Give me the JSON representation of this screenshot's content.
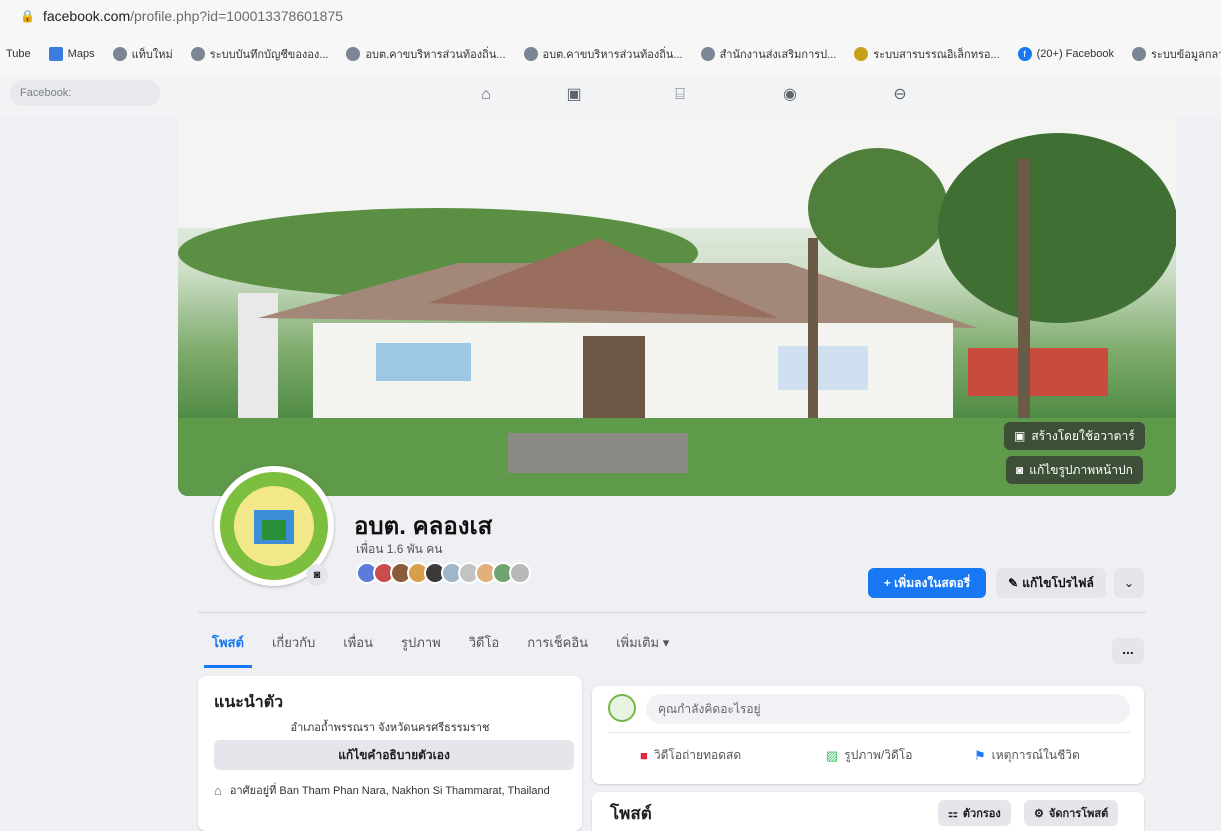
{
  "browser": {
    "url_host": "facebook.com",
    "url_path": "/profile.php?id=100013378601875",
    "bookmarks": [
      {
        "icon": "youtube-icon",
        "label": "Tube"
      },
      {
        "icon": "maps-icon",
        "label": "Maps"
      },
      {
        "icon": "globe-icon",
        "label": "แท็บใหม่"
      },
      {
        "icon": "globe-icon",
        "label": "ระบบบันทึกบัญชีขององ..."
      },
      {
        "icon": "globe-icon",
        "label": "อบต.คาขบริหารส่วนท้องถิ่น..."
      },
      {
        "icon": "globe-icon",
        "label": "อบต.คาขบริหารส่วนท้องถิ่น..."
      },
      {
        "icon": "globe-icon",
        "label": "สำนักงานส่งเสริมการป..."
      },
      {
        "icon": "gov-icon",
        "label": "ระบบสารบรรณอิเล็กทรอ..."
      },
      {
        "icon": "facebook-icon",
        "label": "(20+) Facebook"
      },
      {
        "icon": "globe-icon",
        "label": "ระบบข้อมูลกลางองค์กร..."
      }
    ]
  },
  "fb_nav": {
    "search_placeholder": "Facebook:",
    "icons": [
      "home-icon",
      "watch-icon",
      "marketplace-icon",
      "groups-icon",
      "gaming-icon"
    ]
  },
  "cover": {
    "create_avatar": "สร้างโดยใช้อวาตาร์",
    "edit_cover": "แก้ไขรูปภาพหน้าปก"
  },
  "profile": {
    "name": "อบต. คลองเส",
    "friends": "เพื่อน 1.6 พัน คน",
    "add_story": "+ เพิ่มลงในสตอรี่",
    "edit_profile": "แก้ไขโปรไฟล์",
    "more_chevron": "⌄",
    "friend_colors": [
      "#5b7bd8",
      "#c94b4b",
      "#8a5a3b",
      "#d9a04c",
      "#3a3a3a",
      "#9fb5c9",
      "#c3c3c3",
      "#e2b07d",
      "#6fa36f",
      "#b8b8b8"
    ]
  },
  "tabs": [
    {
      "label": "โพสต์",
      "active": true
    },
    {
      "label": "เกี่ยวกับ",
      "active": false
    },
    {
      "label": "เพื่อน",
      "active": false
    },
    {
      "label": "รูปภาพ",
      "active": false
    },
    {
      "label": "วิดีโอ",
      "active": false
    },
    {
      "label": "การเช็คอิน",
      "active": false
    },
    {
      "label": "เพิ่มเติม ▾",
      "active": false
    }
  ],
  "tab_more": "...",
  "intro": {
    "title": "แนะนำตัว",
    "bio": "อำเภอถ้ำพรรณรา จังหวัดนครศรีธรรมราช",
    "edit_bio": "แก้ไขคำอธิบายตัวเอง",
    "location": "อาศัยอยู่ที่ Ban Tham Phan Nara, Nakhon Si Thammarat, Thailand"
  },
  "composer": {
    "placeholder": "คุณกำลังคิดอะไรอยู่",
    "actions": [
      {
        "icon": "live-video-icon",
        "label": "วิดีโอถ่ายทอดสด",
        "color": "#e42645"
      },
      {
        "icon": "photo-icon",
        "label": "รูปภาพ/วิดีโอ",
        "color": "#45bd62"
      },
      {
        "icon": "flag-icon",
        "label": "เหตุการณ์ในชีวิต",
        "color": "#1877f2"
      }
    ]
  },
  "posts": {
    "title": "โพสต์",
    "filter": "ตัวกรอง",
    "manage": "จัดการโพสต์"
  }
}
